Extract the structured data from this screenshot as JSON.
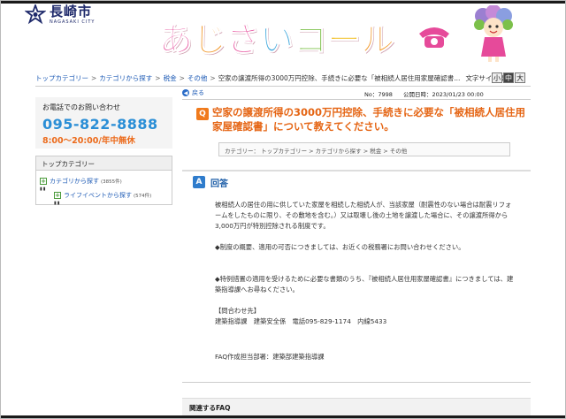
{
  "header": {
    "city_name": "長崎市",
    "city_sub": "NAGASAKI CITY",
    "brand_chars": [
      {
        "ch": "あ",
        "color": "#e64a9a"
      },
      {
        "ch": "じ",
        "color": "#f29a2e"
      },
      {
        "ch": "さ",
        "color": "#e64a9a"
      },
      {
        "ch": "い",
        "color": "#42a9dd"
      },
      {
        "ch": "コ",
        "color": "#7cc04a"
      },
      {
        "ch": "ー",
        "color": "#f2c22e"
      },
      {
        "ch": "ル",
        "color": "#f29a2e"
      }
    ]
  },
  "breadcrumb": {
    "items": [
      "トップカテゴリー",
      "カテゴリから探す",
      "税金",
      "その他"
    ],
    "current": "空家の譲渡所得の3000万円控除、手続きに必要な「被相続人居住用家屋確認書...",
    "text_size_label": "文字サイズ変更",
    "size_buttons": [
      "小",
      "中",
      "大"
    ]
  },
  "sidebar": {
    "contact_label": "お電話でのお問い合わせ",
    "phone": "095-822-8888",
    "hours": "8:00～20:00/年中無休",
    "category_title": "トップカテゴリー",
    "categories": [
      {
        "label": "カテゴリから探す",
        "count": "(3855件)"
      },
      {
        "label": "ライフイベントから探す",
        "count": "(574件)"
      }
    ]
  },
  "main": {
    "back_label": "戻る",
    "number": "No：7998",
    "published": "公開日時：2023/01/23 00:00",
    "question": "空家の譲渡所得の3000万円控除、手続きに必要な「被相続人居住用家屋確認書」について教えてください。",
    "category_path": "カテゴリー： トップカテゴリー > カテゴリから探す > 税金 > その他",
    "answer_label": "回答",
    "answer_p1": "被相続人の居住の用に供していた家屋を相続した相続人が、当該家屋（耐震性のない場合は耐震リフォームをしたものに限り、その敷地を含む。）又は取壊し後の土地を譲渡した場合に、その譲渡所得から3,000万円が特別控除される制度です。",
    "answer_p2": "◆制度の概要、適用の可否につきましては、お近くの税務署にお問い合わせください。",
    "answer_p3": "◆特例措置の適用を受けるために必要な書類のうち、『被相続人居住用家屋確認書』につきましては、建築指導課へお尋ねください。",
    "contact_head": "【問合わせ先】",
    "contact_line": "建築指導課　建築安全係　電話095-829-1174　内線5433",
    "faq_dept": "FAQ作成担当部署：建築部建築指導課",
    "related_label": "関連するFAQ"
  }
}
